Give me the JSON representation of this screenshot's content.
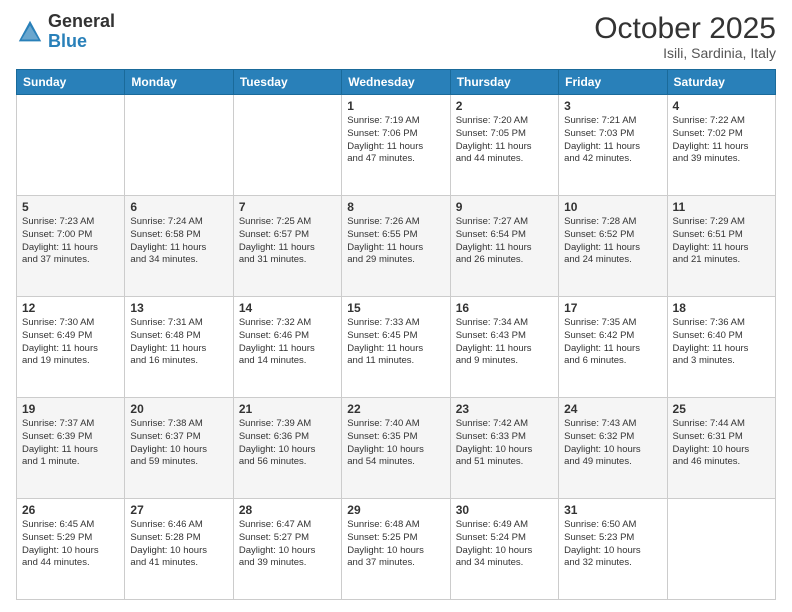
{
  "header": {
    "logo_general": "General",
    "logo_blue": "Blue",
    "month": "October 2025",
    "location": "Isili, Sardinia, Italy"
  },
  "days_of_week": [
    "Sunday",
    "Monday",
    "Tuesday",
    "Wednesday",
    "Thursday",
    "Friday",
    "Saturday"
  ],
  "weeks": [
    [
      {
        "day": "",
        "info": ""
      },
      {
        "day": "",
        "info": ""
      },
      {
        "day": "",
        "info": ""
      },
      {
        "day": "1",
        "info": "Sunrise: 7:19 AM\nSunset: 7:06 PM\nDaylight: 11 hours\nand 47 minutes."
      },
      {
        "day": "2",
        "info": "Sunrise: 7:20 AM\nSunset: 7:05 PM\nDaylight: 11 hours\nand 44 minutes."
      },
      {
        "day": "3",
        "info": "Sunrise: 7:21 AM\nSunset: 7:03 PM\nDaylight: 11 hours\nand 42 minutes."
      },
      {
        "day": "4",
        "info": "Sunrise: 7:22 AM\nSunset: 7:02 PM\nDaylight: 11 hours\nand 39 minutes."
      }
    ],
    [
      {
        "day": "5",
        "info": "Sunrise: 7:23 AM\nSunset: 7:00 PM\nDaylight: 11 hours\nand 37 minutes."
      },
      {
        "day": "6",
        "info": "Sunrise: 7:24 AM\nSunset: 6:58 PM\nDaylight: 11 hours\nand 34 minutes."
      },
      {
        "day": "7",
        "info": "Sunrise: 7:25 AM\nSunset: 6:57 PM\nDaylight: 11 hours\nand 31 minutes."
      },
      {
        "day": "8",
        "info": "Sunrise: 7:26 AM\nSunset: 6:55 PM\nDaylight: 11 hours\nand 29 minutes."
      },
      {
        "day": "9",
        "info": "Sunrise: 7:27 AM\nSunset: 6:54 PM\nDaylight: 11 hours\nand 26 minutes."
      },
      {
        "day": "10",
        "info": "Sunrise: 7:28 AM\nSunset: 6:52 PM\nDaylight: 11 hours\nand 24 minutes."
      },
      {
        "day": "11",
        "info": "Sunrise: 7:29 AM\nSunset: 6:51 PM\nDaylight: 11 hours\nand 21 minutes."
      }
    ],
    [
      {
        "day": "12",
        "info": "Sunrise: 7:30 AM\nSunset: 6:49 PM\nDaylight: 11 hours\nand 19 minutes."
      },
      {
        "day": "13",
        "info": "Sunrise: 7:31 AM\nSunset: 6:48 PM\nDaylight: 11 hours\nand 16 minutes."
      },
      {
        "day": "14",
        "info": "Sunrise: 7:32 AM\nSunset: 6:46 PM\nDaylight: 11 hours\nand 14 minutes."
      },
      {
        "day": "15",
        "info": "Sunrise: 7:33 AM\nSunset: 6:45 PM\nDaylight: 11 hours\nand 11 minutes."
      },
      {
        "day": "16",
        "info": "Sunrise: 7:34 AM\nSunset: 6:43 PM\nDaylight: 11 hours\nand 9 minutes."
      },
      {
        "day": "17",
        "info": "Sunrise: 7:35 AM\nSunset: 6:42 PM\nDaylight: 11 hours\nand 6 minutes."
      },
      {
        "day": "18",
        "info": "Sunrise: 7:36 AM\nSunset: 6:40 PM\nDaylight: 11 hours\nand 3 minutes."
      }
    ],
    [
      {
        "day": "19",
        "info": "Sunrise: 7:37 AM\nSunset: 6:39 PM\nDaylight: 11 hours\nand 1 minute."
      },
      {
        "day": "20",
        "info": "Sunrise: 7:38 AM\nSunset: 6:37 PM\nDaylight: 10 hours\nand 59 minutes."
      },
      {
        "day": "21",
        "info": "Sunrise: 7:39 AM\nSunset: 6:36 PM\nDaylight: 10 hours\nand 56 minutes."
      },
      {
        "day": "22",
        "info": "Sunrise: 7:40 AM\nSunset: 6:35 PM\nDaylight: 10 hours\nand 54 minutes."
      },
      {
        "day": "23",
        "info": "Sunrise: 7:42 AM\nSunset: 6:33 PM\nDaylight: 10 hours\nand 51 minutes."
      },
      {
        "day": "24",
        "info": "Sunrise: 7:43 AM\nSunset: 6:32 PM\nDaylight: 10 hours\nand 49 minutes."
      },
      {
        "day": "25",
        "info": "Sunrise: 7:44 AM\nSunset: 6:31 PM\nDaylight: 10 hours\nand 46 minutes."
      }
    ],
    [
      {
        "day": "26",
        "info": "Sunrise: 6:45 AM\nSunset: 5:29 PM\nDaylight: 10 hours\nand 44 minutes."
      },
      {
        "day": "27",
        "info": "Sunrise: 6:46 AM\nSunset: 5:28 PM\nDaylight: 10 hours\nand 41 minutes."
      },
      {
        "day": "28",
        "info": "Sunrise: 6:47 AM\nSunset: 5:27 PM\nDaylight: 10 hours\nand 39 minutes."
      },
      {
        "day": "29",
        "info": "Sunrise: 6:48 AM\nSunset: 5:25 PM\nDaylight: 10 hours\nand 37 minutes."
      },
      {
        "day": "30",
        "info": "Sunrise: 6:49 AM\nSunset: 5:24 PM\nDaylight: 10 hours\nand 34 minutes."
      },
      {
        "day": "31",
        "info": "Sunrise: 6:50 AM\nSunset: 5:23 PM\nDaylight: 10 hours\nand 32 minutes."
      },
      {
        "day": "",
        "info": ""
      }
    ]
  ]
}
